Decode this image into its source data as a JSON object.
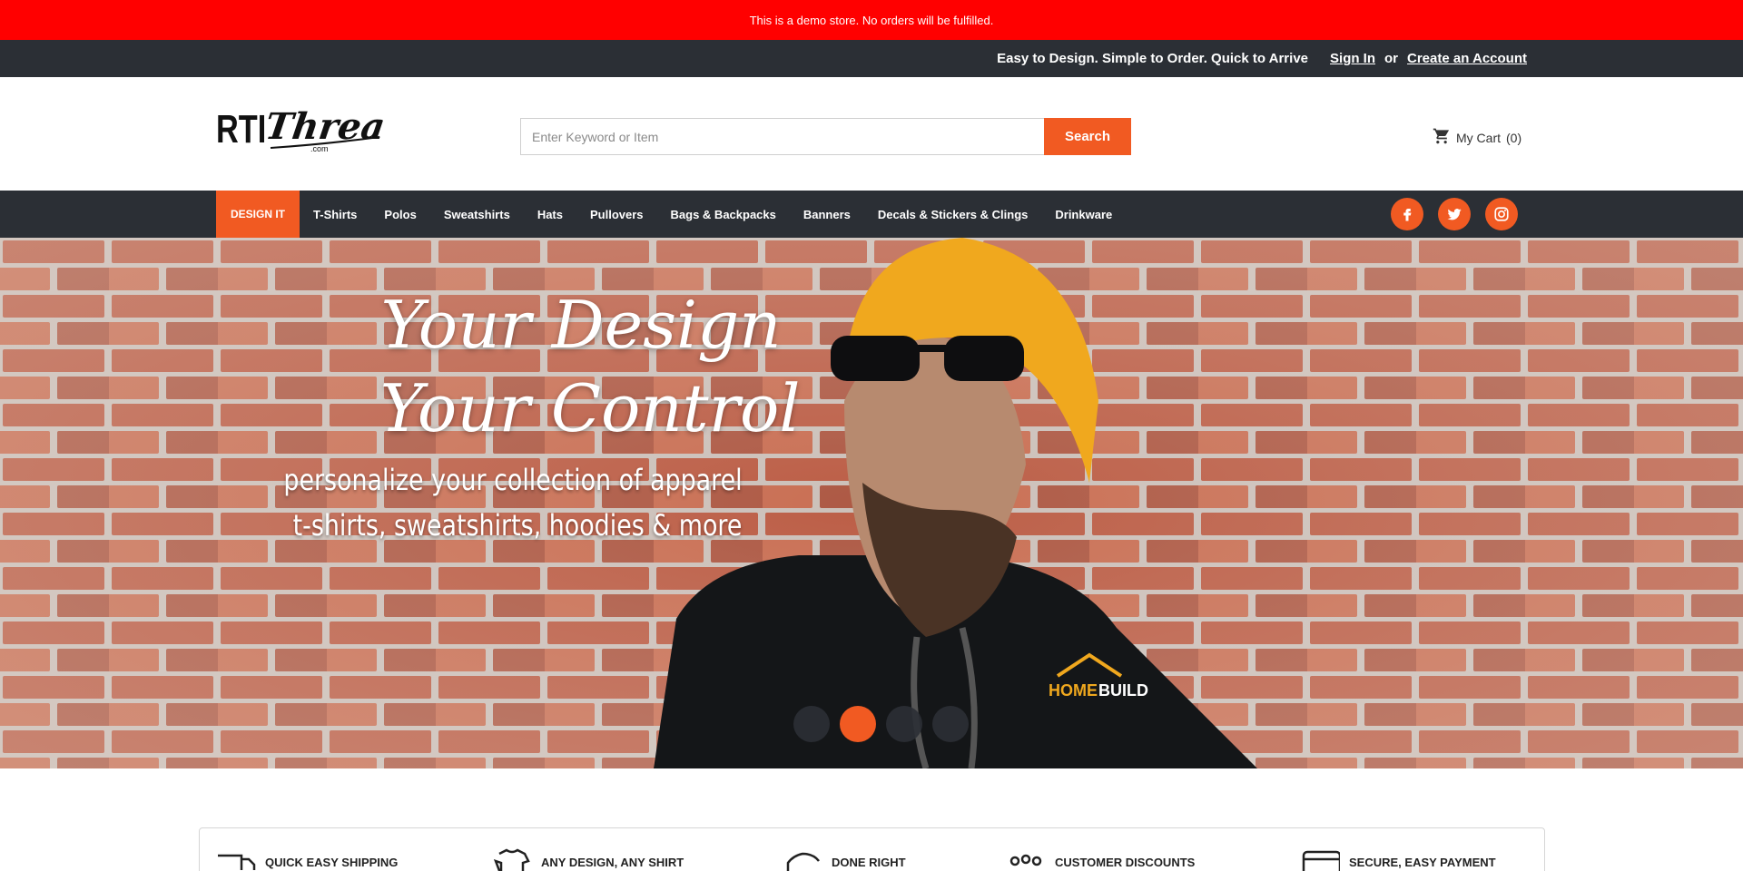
{
  "demo_notice": "This is a demo store. No orders will be fulfilled.",
  "top_bar": {
    "tagline": "Easy to Design. Simple to Order. Quick to Arrive",
    "sign_in": "Sign In",
    "or": "or",
    "create_account": "Create an Account"
  },
  "header": {
    "logo_text": "RTI Threads .com",
    "search_placeholder": "Enter Keyword or Item",
    "search_button": "Search",
    "cart_label": "My Cart",
    "cart_count": "(0)"
  },
  "nav": {
    "items": [
      "DESIGN IT",
      "T-Shirts",
      "Polos",
      "Sweatshirts",
      "Hats",
      "Pullovers",
      "Bags & Backpacks",
      "Banners",
      "Decals & Stickers & Clings",
      "Drinkware"
    ],
    "social": [
      "facebook-icon",
      "twitter-icon",
      "instagram-icon"
    ]
  },
  "hero": {
    "headline_line1": "Your Design",
    "headline_line2": "Your Control",
    "sub_line1": "personalize your collection of apparel",
    "sub_line2": "t-shirts, sweatshirts, hoodies & more",
    "slides": 4,
    "active_slide": 2
  },
  "features": [
    {
      "icon": "shipping-truck-icon",
      "label": "QUICK EASY SHIPPING"
    },
    {
      "icon": "tshirt-icon",
      "label": "ANY DESIGN, ANY SHIRT"
    },
    {
      "icon": "thumbs-up-icon",
      "label": "DONE RIGHT"
    },
    {
      "icon": "group-icon",
      "label": "CUSTOMER DISCOUNTS"
    },
    {
      "icon": "credit-card-icon",
      "label": "SECURE, EASY PAYMENT"
    }
  ],
  "colors": {
    "accent": "#f15a22",
    "dark": "#2b2f35",
    "demo_red": "#ff0000"
  }
}
